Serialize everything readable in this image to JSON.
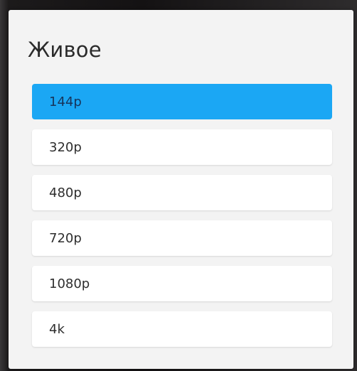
{
  "dialog": {
    "title": "Живое",
    "options": [
      {
        "label": "144p",
        "selected": true
      },
      {
        "label": "320p",
        "selected": false
      },
      {
        "label": "480p",
        "selected": false
      },
      {
        "label": "720p",
        "selected": false
      },
      {
        "label": "1080p",
        "selected": false
      },
      {
        "label": "4k",
        "selected": false
      }
    ]
  },
  "colors": {
    "selected_background": "#1ba7f4",
    "option_background": "#ffffff",
    "dialog_background": "#f3f3f3"
  }
}
